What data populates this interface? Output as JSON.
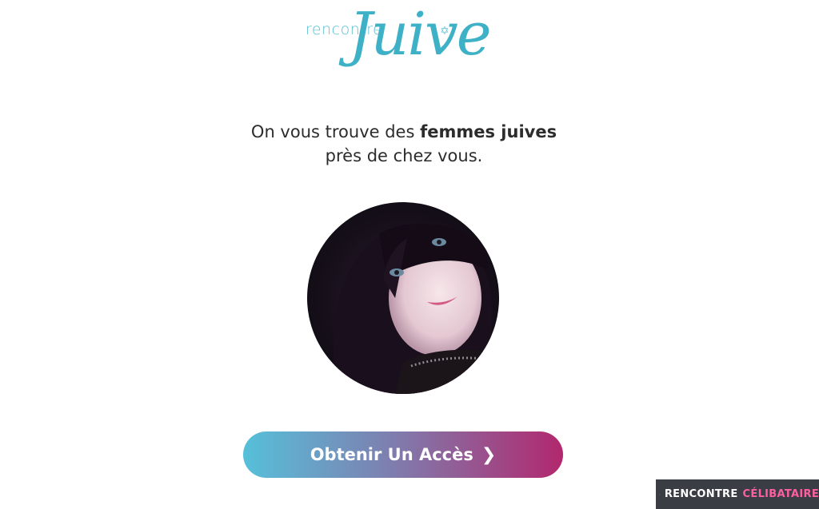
{
  "logo": {
    "small_text": "rencontre",
    "script_text": "Juive",
    "brand_color": "#3fb1c7"
  },
  "headline": {
    "line1_prefix": "On vous trouve des ",
    "line1_bold": "femmes juives",
    "line2": "près de chez vous."
  },
  "profile": {
    "avatar_icon": "profile-photo"
  },
  "cta": {
    "label": "Obtenir Un Accès",
    "icon": "chevron-right-icon",
    "gradient_start": "#56c0da",
    "gradient_end": "#b2286e"
  },
  "watermark": {
    "word1": "RENCONTRE",
    "word2": "CÉLIBATAIRE",
    "accent": "#ff5fa0"
  }
}
